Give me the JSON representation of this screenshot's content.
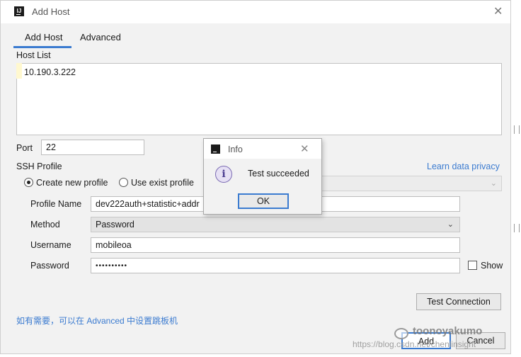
{
  "window": {
    "title": "Add Host",
    "app_icon": "intellij-icon",
    "close_label": "✕"
  },
  "tabs": [
    {
      "label": "Add Host",
      "active": true
    },
    {
      "label": "Advanced",
      "active": false
    }
  ],
  "host_list": {
    "label": "Host List",
    "value": "10.190.3.222"
  },
  "port": {
    "label": "Port",
    "value": "22"
  },
  "ssh_profile": {
    "label": "SSH Profile",
    "privacy_link": "Learn data privacy",
    "create_option": "Create new profile",
    "exist_option": "Use exist profile",
    "selected": "create"
  },
  "profile_name": {
    "label": "Profile Name",
    "value": "dev222auth+statistic+addr"
  },
  "method": {
    "label": "Method",
    "value": "Password"
  },
  "username": {
    "label": "Username",
    "value": "mobileoa"
  },
  "password": {
    "label": "Password",
    "value": "••••••••••"
  },
  "show_label": "Show",
  "test_connection_label": "Test Connection",
  "hint": "如有需要，可以在 Advanced 中设置跳板机",
  "footer": {
    "add_label": "Add",
    "cancel_label": "Cancel"
  },
  "watermark": {
    "name": "toonoyakumo",
    "url": "https://blog.csdn.net/chenlinsight"
  },
  "info_dialog": {
    "title": "Info",
    "message": "Test succeeded",
    "ok_label": "OK",
    "close_label": "✕",
    "icon": "info-icon"
  },
  "colors": {
    "accent": "#3b7bd0",
    "window_bg": "#f2f2f2",
    "input_bg": "#ffffff"
  }
}
